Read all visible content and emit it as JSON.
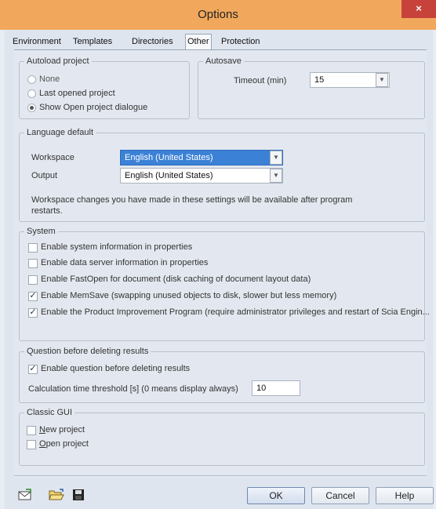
{
  "window": {
    "title": "Options",
    "close_glyph": "×"
  },
  "tabs": [
    {
      "label": "Environment"
    },
    {
      "label": "Templates"
    },
    {
      "label": "Directories"
    },
    {
      "label": "Other",
      "active": true
    },
    {
      "label": "Protection"
    }
  ],
  "autoload": {
    "legend": "Autoload project",
    "options": [
      {
        "label": "None",
        "selected": false
      },
      {
        "label": "Last opened project",
        "selected": false
      },
      {
        "label": "Show Open project dialogue",
        "selected": true
      }
    ]
  },
  "autosave": {
    "legend": "Autosave",
    "timeout_label": "Timeout (min)",
    "timeout_value": "15"
  },
  "language": {
    "legend": "Language default",
    "workspace_label": "Workspace",
    "workspace_value": "English (United States)",
    "output_label": "Output",
    "output_value": "English (United States)",
    "note": "Workspace changes you have made in these settings will be available after program restarts."
  },
  "system": {
    "legend": "System",
    "items": [
      {
        "label": "Enable system information in properties",
        "checked": false
      },
      {
        "label": "Enable data server information in properties",
        "checked": false
      },
      {
        "label": "Enable FastOpen for document (disk caching of document layout data)",
        "checked": false
      },
      {
        "label": "Enable MemSave (swapping unused objects to disk, slower but less memory)",
        "checked": true
      },
      {
        "label": "Enable the Product Improvement Program (require administrator privileges and restart of Scia Engin...",
        "checked": true
      }
    ]
  },
  "question": {
    "legend": "Question before deleting results",
    "enable_label": "Enable question before deleting results",
    "enable_checked": true,
    "threshold_label": "Calculation time threshold [s] (0 means display always)",
    "threshold_value": "10"
  },
  "classic": {
    "legend": "Classic GUI",
    "new_project": {
      "first": "N",
      "rest": "ew project",
      "checked": false
    },
    "open_project": {
      "first": "O",
      "rest": "pen project",
      "checked": false
    }
  },
  "buttons": {
    "ok": "OK",
    "cancel": "Cancel",
    "help": "Help"
  },
  "toolbar_icons": [
    "envelope-icon",
    "open-folder-icon",
    "save-disk-icon"
  ],
  "colors": {
    "titlebar": "#f1a85c",
    "close": "#c7423a",
    "selection": "#3b82d6"
  }
}
